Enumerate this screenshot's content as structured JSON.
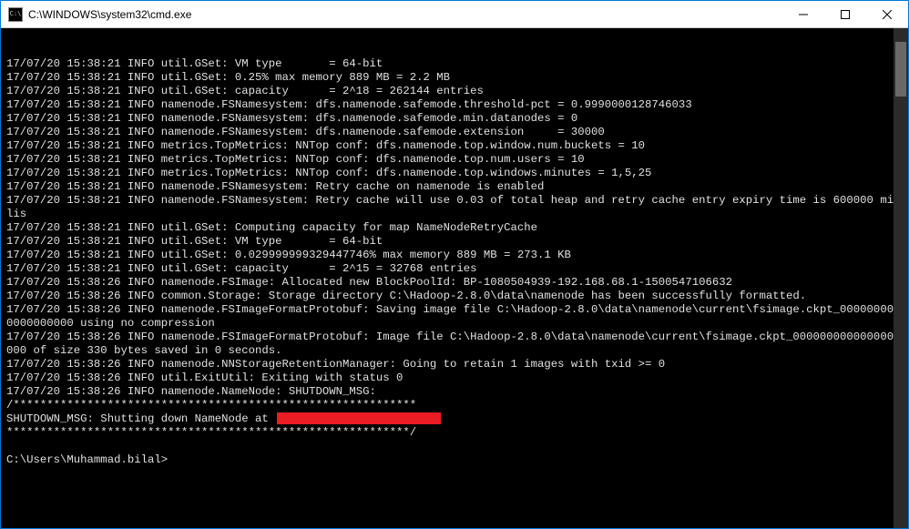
{
  "window": {
    "title": "C:\\WINDOWS\\system32\\cmd.exe",
    "icon_label": "C:\\"
  },
  "log_lines": [
    "17/07/20 15:38:21 INFO util.GSet: VM type       = 64-bit",
    "17/07/20 15:38:21 INFO util.GSet: 0.25% max memory 889 MB = 2.2 MB",
    "17/07/20 15:38:21 INFO util.GSet: capacity      = 2^18 = 262144 entries",
    "17/07/20 15:38:21 INFO namenode.FSNamesystem: dfs.namenode.safemode.threshold-pct = 0.9990000128746033",
    "17/07/20 15:38:21 INFO namenode.FSNamesystem: dfs.namenode.safemode.min.datanodes = 0",
    "17/07/20 15:38:21 INFO namenode.FSNamesystem: dfs.namenode.safemode.extension     = 30000",
    "17/07/20 15:38:21 INFO metrics.TopMetrics: NNTop conf: dfs.namenode.top.window.num.buckets = 10",
    "17/07/20 15:38:21 INFO metrics.TopMetrics: NNTop conf: dfs.namenode.top.num.users = 10",
    "17/07/20 15:38:21 INFO metrics.TopMetrics: NNTop conf: dfs.namenode.top.windows.minutes = 1,5,25",
    "17/07/20 15:38:21 INFO namenode.FSNamesystem: Retry cache on namenode is enabled",
    "17/07/20 15:38:21 INFO namenode.FSNamesystem: Retry cache will use 0.03 of total heap and retry cache entry expiry time is 600000 millis",
    "17/07/20 15:38:21 INFO util.GSet: Computing capacity for map NameNodeRetryCache",
    "17/07/20 15:38:21 INFO util.GSet: VM type       = 64-bit",
    "17/07/20 15:38:21 INFO util.GSet: 0.029999999329447746% max memory 889 MB = 273.1 KB",
    "17/07/20 15:38:21 INFO util.GSet: capacity      = 2^15 = 32768 entries",
    "17/07/20 15:38:26 INFO namenode.FSImage: Allocated new BlockPoolId: BP-1080504939-192.168.68.1-1500547106632",
    "17/07/20 15:38:26 INFO common.Storage: Storage directory C:\\Hadoop-2.8.0\\data\\namenode has been successfully formatted.",
    "17/07/20 15:38:26 INFO namenode.FSImageFormatProtobuf: Saving image file C:\\Hadoop-2.8.0\\data\\namenode\\current\\fsimage.ckpt_0000000000000000000 using no compression",
    "17/07/20 15:38:26 INFO namenode.FSImageFormatProtobuf: Image file C:\\Hadoop-2.8.0\\data\\namenode\\current\\fsimage.ckpt_0000000000000000000 of size 330 bytes saved in 0 seconds.",
    "17/07/20 15:38:26 INFO namenode.NNStorageRetentionManager: Going to retain 1 images with txid >= 0",
    "17/07/20 15:38:26 INFO util.ExitUtil: Exiting with status 0",
    "17/07/20 15:38:26 INFO namenode.NameNode: SHUTDOWN_MSG:"
  ],
  "shutdown": {
    "border_top": "/************************************************************",
    "msg_prefix": "SHUTDOWN_MSG: Shutting down NameNode at ",
    "border_bottom": "************************************************************/"
  },
  "prompt": "C:\\Users\\Muhammad.bilal>"
}
